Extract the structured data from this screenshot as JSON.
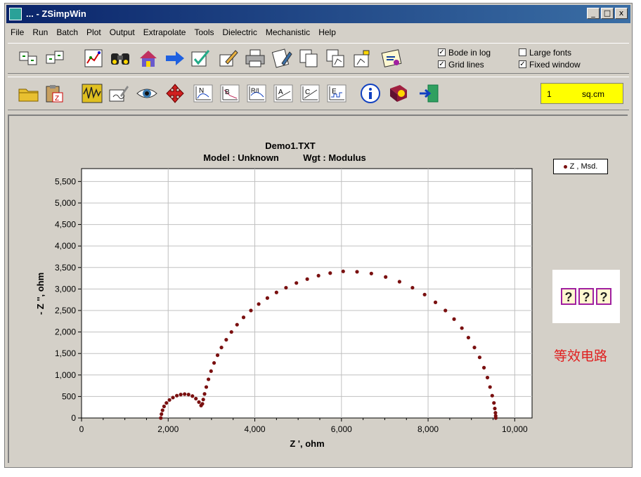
{
  "window": {
    "title": "... - ZSimpWin",
    "min": "_",
    "max": "□",
    "close": "x"
  },
  "menu": [
    "File",
    "Run",
    "Batch",
    "Plot",
    "Output",
    "Extrapolate",
    "Tools",
    "Dielectric",
    "Mechanistic",
    "Help"
  ],
  "options": {
    "bode_in_log": {
      "label": "Bode in log",
      "checked": true
    },
    "grid_lines": {
      "label": "Grid lines",
      "checked": true
    },
    "large_fonts": {
      "label": "Large fonts",
      "checked": false
    },
    "fixed_window": {
      "label": "Fixed window",
      "checked": true
    }
  },
  "area": {
    "value": "1",
    "unit": "sq.cm"
  },
  "toolbar2_labels": [
    "N",
    "B",
    "R/I",
    "A",
    "C",
    "E"
  ],
  "legend": {
    "label": "Z , Msd."
  },
  "circuit": {
    "placeholders": [
      "?",
      "?",
      "?"
    ],
    "caption": "等效电路"
  },
  "chart_data": {
    "type": "scatter",
    "title": "Demo1.TXT",
    "subtitle_model": "Model : Unknown",
    "subtitle_wgt": "Wgt : Modulus",
    "xlabel": "Z ', ohm",
    "ylabel": "- Z '', ohm",
    "xlim": [
      0,
      10400
    ],
    "ylim": [
      0,
      5800
    ],
    "xticks": [
      0,
      2000,
      4000,
      6000,
      8000,
      10000
    ],
    "xtick_labels": [
      "0",
      "2,000",
      "4,000",
      "6,000",
      "8,000",
      "10,000"
    ],
    "yticks": [
      0,
      500,
      1000,
      1500,
      2000,
      2500,
      3000,
      3500,
      4000,
      4500,
      5000,
      5500
    ],
    "ytick_labels": [
      "0",
      "500",
      "1,000",
      "1,500",
      "2,000",
      "2,500",
      "3,000",
      "3,500",
      "4,000",
      "4,500",
      "5,000",
      "5,500"
    ],
    "grid": true,
    "point_color": "#7a1010",
    "series": [
      {
        "name": "Z , Msd.",
        "points": [
          [
            1830,
            0
          ],
          [
            1845,
            90
          ],
          [
            1870,
            180
          ],
          [
            1905,
            270
          ],
          [
            1960,
            350
          ],
          [
            2030,
            420
          ],
          [
            2110,
            475
          ],
          [
            2200,
            520
          ],
          [
            2290,
            545
          ],
          [
            2380,
            555
          ],
          [
            2470,
            545
          ],
          [
            2560,
            510
          ],
          [
            2640,
            450
          ],
          [
            2710,
            370
          ],
          [
            2760,
            290
          ],
          [
            2790,
            330
          ],
          [
            2810,
            430
          ],
          [
            2840,
            560
          ],
          [
            2880,
            720
          ],
          [
            2930,
            900
          ],
          [
            2990,
            1090
          ],
          [
            3060,
            1280
          ],
          [
            3140,
            1460
          ],
          [
            3230,
            1640
          ],
          [
            3340,
            1820
          ],
          [
            3460,
            2000
          ],
          [
            3590,
            2170
          ],
          [
            3740,
            2340
          ],
          [
            3910,
            2500
          ],
          [
            4090,
            2650
          ],
          [
            4290,
            2790
          ],
          [
            4500,
            2920
          ],
          [
            4720,
            3030
          ],
          [
            4960,
            3140
          ],
          [
            5210,
            3230
          ],
          [
            5470,
            3310
          ],
          [
            5740,
            3370
          ],
          [
            6040,
            3410
          ],
          [
            6360,
            3400
          ],
          [
            6690,
            3360
          ],
          [
            7020,
            3280
          ],
          [
            7340,
            3170
          ],
          [
            7640,
            3030
          ],
          [
            7920,
            2870
          ],
          [
            8170,
            2690
          ],
          [
            8400,
            2500
          ],
          [
            8600,
            2300
          ],
          [
            8780,
            2090
          ],
          [
            8930,
            1870
          ],
          [
            9070,
            1640
          ],
          [
            9190,
            1410
          ],
          [
            9290,
            1170
          ],
          [
            9370,
            940
          ],
          [
            9430,
            720
          ],
          [
            9480,
            520
          ],
          [
            9520,
            350
          ],
          [
            9540,
            220
          ],
          [
            9555,
            120
          ],
          [
            9560,
            50
          ],
          [
            9562,
            0
          ]
        ]
      }
    ]
  }
}
